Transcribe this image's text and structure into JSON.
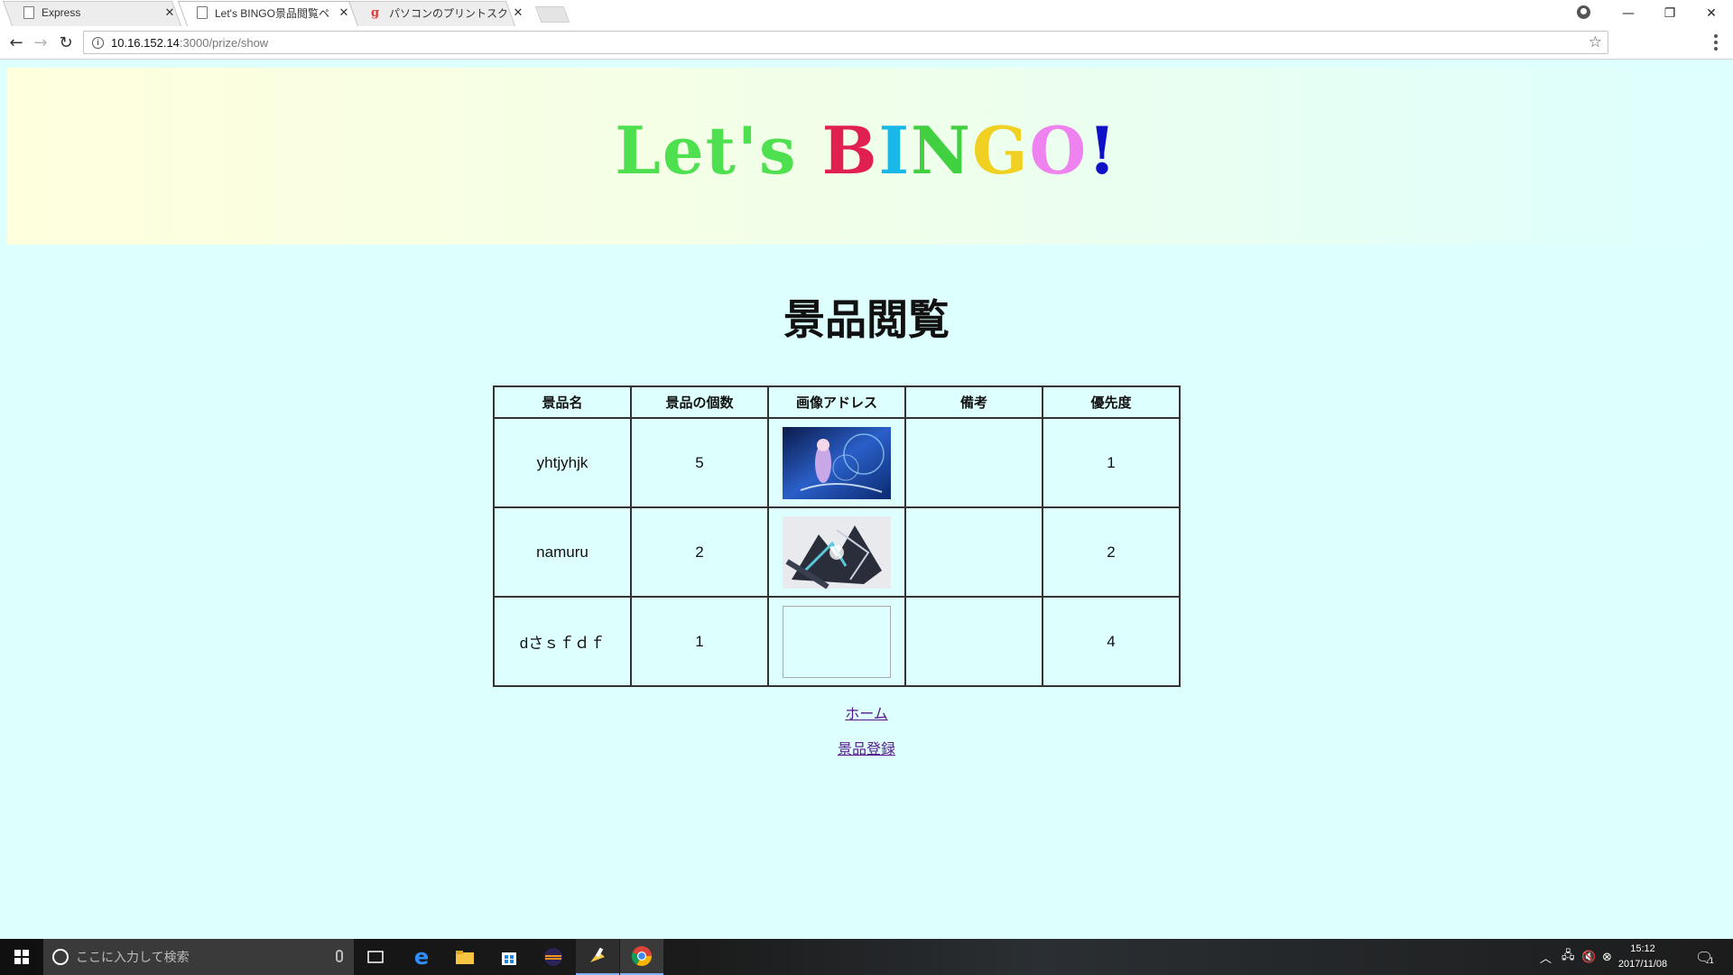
{
  "browser": {
    "tabs": [
      {
        "title": "Express",
        "icon": "page-icon"
      },
      {
        "title": "Let's BINGO景品閲覧ペー",
        "icon": "page-icon"
      },
      {
        "title": "パソコンのプリントスクリーンで",
        "icon": "g-favicon-icon"
      }
    ],
    "url_host": "10.16.152.14",
    "url_path": ":3000/prize/show"
  },
  "page": {
    "logo": {
      "letters": [
        {
          "ch": "L",
          "color": "#4ee04e"
        },
        {
          "ch": "e",
          "color": "#4ee04e"
        },
        {
          "ch": "t",
          "color": "#4ee04e"
        },
        {
          "ch": "'",
          "color": "#4ee04e"
        },
        {
          "ch": "s",
          "color": "#4ee04e"
        },
        {
          "ch": " ",
          "color": "#4ee04e"
        },
        {
          "ch": "B",
          "color": "#e02050"
        },
        {
          "ch": "I",
          "color": "#1ab8e8"
        },
        {
          "ch": "N",
          "color": "#40d040"
        },
        {
          "ch": "G",
          "color": "#f0d020"
        },
        {
          "ch": "O",
          "color": "#ee82ee"
        },
        {
          "ch": "!",
          "color": "#1010c8"
        }
      ]
    },
    "title": "景品閲覧",
    "table": {
      "headers": [
        "景品名",
        "景品の個数",
        "画像アドレス",
        "備考",
        "優先度"
      ],
      "rows": [
        {
          "name": "yhtjyhjk",
          "count": "5",
          "image": "anime-girl-blue",
          "note": "",
          "priority": "1"
        },
        {
          "name": "namuru",
          "count": "2",
          "image": "anime-mecha-dark",
          "note": "",
          "priority": "2"
        },
        {
          "name": "dさｓｆｄｆ",
          "count": "1",
          "image": "",
          "note": "",
          "priority": "4"
        }
      ]
    },
    "links": {
      "home": "ホーム",
      "register": "景品登録"
    }
  },
  "taskbar": {
    "search_placeholder": "ここに入力して検索",
    "time": "15:12",
    "date": "2017/11/08",
    "notification_count": "1"
  }
}
